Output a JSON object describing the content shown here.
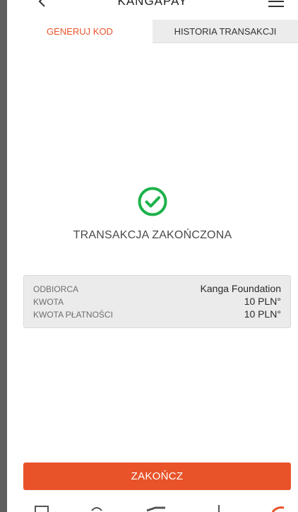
{
  "header": {
    "title": "KANGAPAY",
    "back_icon": "chevron-left-icon",
    "menu_icon": "hamburger-menu-icon"
  },
  "tabs": [
    {
      "label": "GENERUJ KOD",
      "active": true
    },
    {
      "label": "HISTORIA TRANSAKCJI",
      "active": false
    }
  ],
  "status": {
    "icon": "check-circle-icon",
    "text": "TRANSAKCJA ZAKOŃCZONA"
  },
  "details": {
    "rows": [
      {
        "label": "ODBIORCA",
        "value": "Kanga Foundation"
      },
      {
        "label": "KWOTA",
        "value": "10 PLN°"
      },
      {
        "label": "KWOTA PŁATNOŚCI",
        "value": "10 PLN°"
      }
    ]
  },
  "actions": {
    "finish_label": "ZAKOŃCZ"
  },
  "bottom_nav": {
    "icons": [
      "wallet-icon",
      "exchange-icon",
      "card-icon",
      "payment-icon",
      "kanga-icon"
    ]
  },
  "colors": {
    "accent": "#e8532a",
    "success": "#1db24a",
    "panel": "#ebebeb",
    "inactive_tab": "#ececec"
  }
}
